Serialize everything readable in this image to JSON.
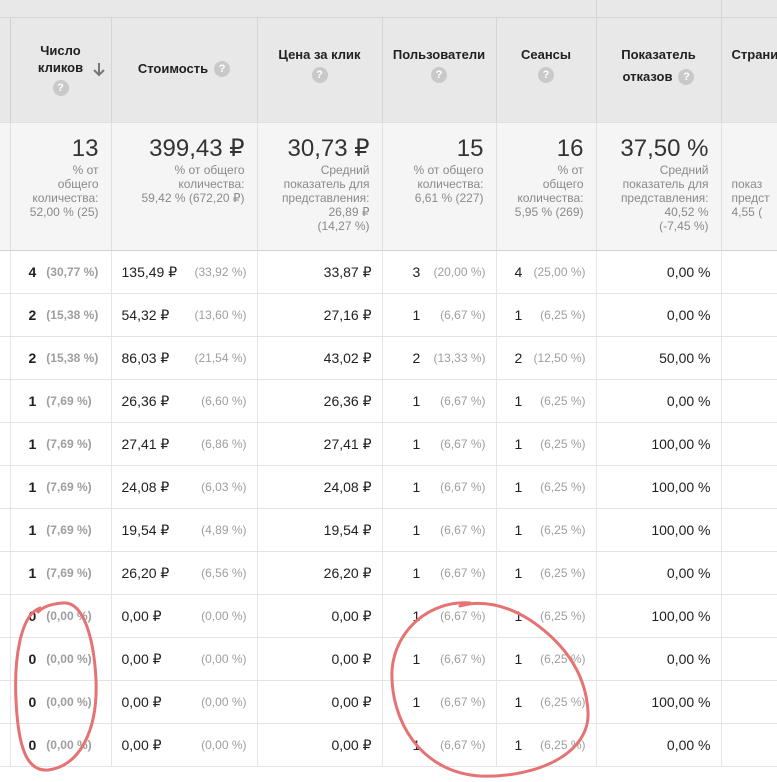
{
  "columns": {
    "clicks": {
      "line1": "Число",
      "line2": "кликов"
    },
    "cost": "Стоимость",
    "cpc": "Цена за клик",
    "users": "Пользователи",
    "sessions": "Сеансы",
    "bounce": {
      "line1": "Показатель",
      "line2": "отказов"
    },
    "pages": "Страни"
  },
  "totals": {
    "clicks": {
      "value": "13",
      "sub": [
        "% от",
        "общего",
        "количества:",
        "52,00 % (25)"
      ]
    },
    "cost": {
      "value": "399,43 ₽",
      "sub": [
        "% от общего",
        "количества:",
        "59,42 % (672,20 ₽)"
      ]
    },
    "cpc": {
      "value": "30,73 ₽",
      "sub": [
        "Средний",
        "показатель для",
        "представления:",
        "26,89 ₽",
        "(14,27 %)"
      ]
    },
    "users": {
      "value": "15",
      "sub": [
        "% от общего",
        "количества:",
        "6,61 % (227)"
      ]
    },
    "sessions": {
      "value": "16",
      "sub": [
        "% от",
        "общего",
        "количества:",
        "5,95 % (269)"
      ]
    },
    "bounce": {
      "value": "37,50 %",
      "sub": [
        "Средний",
        "показатель для",
        "представления:",
        "40,52 %",
        "(-7,45 %)"
      ]
    },
    "pages": {
      "sub": [
        "показ",
        "предст",
        "4,55 ("
      ]
    }
  },
  "rows": [
    {
      "clicks": "4",
      "clicks_pct": "(30,77 %)",
      "cost": "135,49 ₽",
      "cost_pct": "(33,92 %)",
      "cpc": "33,87 ₽",
      "users": "3",
      "users_pct": "(20,00 %)",
      "sessions": "4",
      "sessions_pct": "(25,00 %)",
      "bounce": "0,00 %"
    },
    {
      "clicks": "2",
      "clicks_pct": "(15,38 %)",
      "cost": "54,32 ₽",
      "cost_pct": "(13,60 %)",
      "cpc": "27,16 ₽",
      "users": "1",
      "users_pct": "(6,67 %)",
      "sessions": "1",
      "sessions_pct": "(6,25 %)",
      "bounce": "0,00 %"
    },
    {
      "clicks": "2",
      "clicks_pct": "(15,38 %)",
      "cost": "86,03 ₽",
      "cost_pct": "(21,54 %)",
      "cpc": "43,02 ₽",
      "users": "2",
      "users_pct": "(13,33 %)",
      "sessions": "2",
      "sessions_pct": "(12,50 %)",
      "bounce": "50,00 %"
    },
    {
      "clicks": "1",
      "clicks_pct": "(7,69 %)",
      "cost": "26,36 ₽",
      "cost_pct": "(6,60 %)",
      "cpc": "26,36 ₽",
      "users": "1",
      "users_pct": "(6,67 %)",
      "sessions": "1",
      "sessions_pct": "(6,25 %)",
      "bounce": "0,00 %"
    },
    {
      "clicks": "1",
      "clicks_pct": "(7,69 %)",
      "cost": "27,41 ₽",
      "cost_pct": "(6,86 %)",
      "cpc": "27,41 ₽",
      "users": "1",
      "users_pct": "(6,67 %)",
      "sessions": "1",
      "sessions_pct": "(6,25 %)",
      "bounce": "100,00 %"
    },
    {
      "clicks": "1",
      "clicks_pct": "(7,69 %)",
      "cost": "24,08 ₽",
      "cost_pct": "(6,03 %)",
      "cpc": "24,08 ₽",
      "users": "1",
      "users_pct": "(6,67 %)",
      "sessions": "1",
      "sessions_pct": "(6,25 %)",
      "bounce": "100,00 %"
    },
    {
      "clicks": "1",
      "clicks_pct": "(7,69 %)",
      "cost": "19,54 ₽",
      "cost_pct": "(4,89 %)",
      "cpc": "19,54 ₽",
      "users": "1",
      "users_pct": "(6,67 %)",
      "sessions": "1",
      "sessions_pct": "(6,25 %)",
      "bounce": "100,00 %"
    },
    {
      "clicks": "1",
      "clicks_pct": "(7,69 %)",
      "cost": "26,20 ₽",
      "cost_pct": "(6,56 %)",
      "cpc": "26,20 ₽",
      "users": "1",
      "users_pct": "(6,67 %)",
      "sessions": "1",
      "sessions_pct": "(6,25 %)",
      "bounce": "0,00 %"
    },
    {
      "clicks": "0",
      "clicks_pct": "(0,00 %)",
      "cost": "0,00 ₽",
      "cost_pct": "(0,00 %)",
      "cpc": "0,00 ₽",
      "users": "1",
      "users_pct": "(6,67 %)",
      "sessions": "1",
      "sessions_pct": "(6,25 %)",
      "bounce": "100,00 %"
    },
    {
      "clicks": "0",
      "clicks_pct": "(0,00 %)",
      "cost": "0,00 ₽",
      "cost_pct": "(0,00 %)",
      "cpc": "0,00 ₽",
      "users": "1",
      "users_pct": "(6,67 %)",
      "sessions": "1",
      "sessions_pct": "(6,25 %)",
      "bounce": "0,00 %"
    },
    {
      "clicks": "0",
      "clicks_pct": "(0,00 %)",
      "cost": "0,00 ₽",
      "cost_pct": "(0,00 %)",
      "cpc": "0,00 ₽",
      "users": "1",
      "users_pct": "(6,67 %)",
      "sessions": "1",
      "sessions_pct": "(6,25 %)",
      "bounce": "100,00 %"
    },
    {
      "clicks": "0",
      "clicks_pct": "(0,00 %)",
      "cost": "0,00 ₽",
      "cost_pct": "(0,00 %)",
      "cpc": "0,00 ₽",
      "users": "1",
      "users_pct": "(6,67 %)",
      "sessions": "1",
      "sessions_pct": "(6,25 %)",
      "bounce": "0,00 %"
    }
  ],
  "help_glyph": "?",
  "colors": {
    "annotation": "#e57373",
    "header_bg": "#e8e8e8",
    "totals_bg": "#f5f5f5"
  }
}
